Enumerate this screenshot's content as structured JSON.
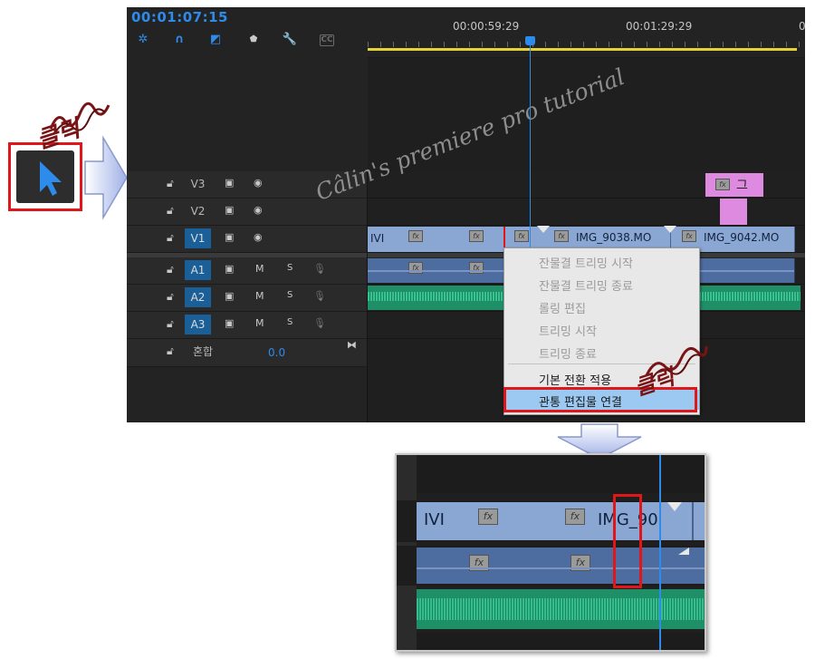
{
  "timecode": "00:01:07:15",
  "toolbar": {
    "icons": [
      "ripple-icon",
      "snap-icon",
      "linked-selection-icon",
      "marker-icon",
      "wrench-icon",
      "captions-icon"
    ],
    "captions_label": "CC"
  },
  "ruler": {
    "labels": [
      "00:00:59:29",
      "00:01:29:29",
      "0"
    ]
  },
  "tracks": {
    "video": [
      {
        "name": "V3"
      },
      {
        "name": "V2"
      },
      {
        "name": "V1",
        "selected": true
      }
    ],
    "audio": [
      {
        "name": "A1",
        "m": "M",
        "s": "S"
      },
      {
        "name": "A2",
        "m": "M",
        "s": "S"
      },
      {
        "name": "A3",
        "m": "M",
        "s": "S"
      }
    ],
    "mix": {
      "name": "혼합",
      "value": "0.0"
    }
  },
  "clips": {
    "v1_first_label": "IVI",
    "v1_clip_a": "IMG_9038.MO",
    "v1_clip_b": "IMG_9042.MO",
    "v3_title_label": "그",
    "fx_label": "fx"
  },
  "context_menu": {
    "items": [
      {
        "label": "잔물결 트리밍 시작",
        "enabled": false
      },
      {
        "label": "잔물결 트리밍 종료",
        "enabled": false
      },
      {
        "label": "롤링 편집",
        "enabled": false
      },
      {
        "label": "트리밍 시작",
        "enabled": false
      },
      {
        "label": "트리밍 종료",
        "enabled": false
      },
      {
        "label": "기본 전환 적용",
        "enabled": true
      },
      {
        "label": "관통 편집물 연결",
        "enabled": true,
        "highlighted": true
      }
    ]
  },
  "annotations": {
    "click_1": "클릭",
    "click_2": "클릭",
    "watermark": "Câlin's premiere pro tutorial"
  },
  "zoom": {
    "v_label_first": "IVI",
    "v_label_clip": "IMG_90",
    "fx_label": "fx"
  },
  "colors": {
    "accent_blue": "#2d8ceb",
    "video_clip": "#8aa7d4",
    "audio_clip": "#4d6ca0",
    "audio_green": "#1f8f68",
    "title_clip": "#de8ae0",
    "highlight_red": "#e0161b",
    "menu_highlight": "#9bc9f1"
  }
}
